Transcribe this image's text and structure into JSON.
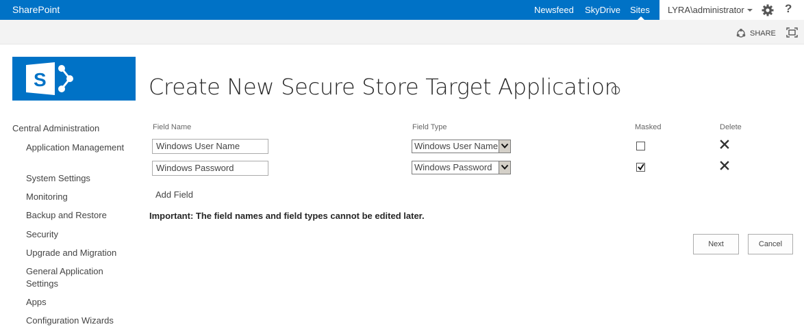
{
  "suite_bar": {
    "brand": "SharePoint",
    "nav": [
      "Newsfeed",
      "SkyDrive",
      "Sites"
    ],
    "user": "LYRA\\administrator",
    "help": "?"
  },
  "ribbon": {
    "share_label": "SHARE"
  },
  "page_title": "Create New Secure Store Target Application",
  "left_nav": {
    "root": "Central Administration",
    "items": [
      "Application Management",
      "System Settings",
      "Monitoring",
      "Backup and Restore",
      "Security",
      "Upgrade and Migration",
      "General Application Settings",
      "Apps",
      "Configuration Wizards"
    ]
  },
  "form": {
    "headers": {
      "field_name": "Field Name",
      "field_type": "Field Type",
      "masked": "Masked",
      "delete": "Delete"
    },
    "rows": [
      {
        "field_name": "Windows User Name",
        "field_type": "Windows User Name",
        "masked": false
      },
      {
        "field_name": "Windows Password",
        "field_type": "Windows Password",
        "masked": true
      }
    ],
    "add_field": "Add Field",
    "important_note": "Important: The field names and field types cannot be edited later.",
    "next_label": "Next",
    "cancel_label": "Cancel"
  },
  "colors": {
    "brand_blue": "#0072c6",
    "ribbon_gray": "#f3f3f3"
  },
  "icons": [
    "gear-icon",
    "help-icon",
    "share-icon",
    "focus-icon",
    "info-icon",
    "delete-icon",
    "chevron-down-icon",
    "checkmark-icon"
  ]
}
